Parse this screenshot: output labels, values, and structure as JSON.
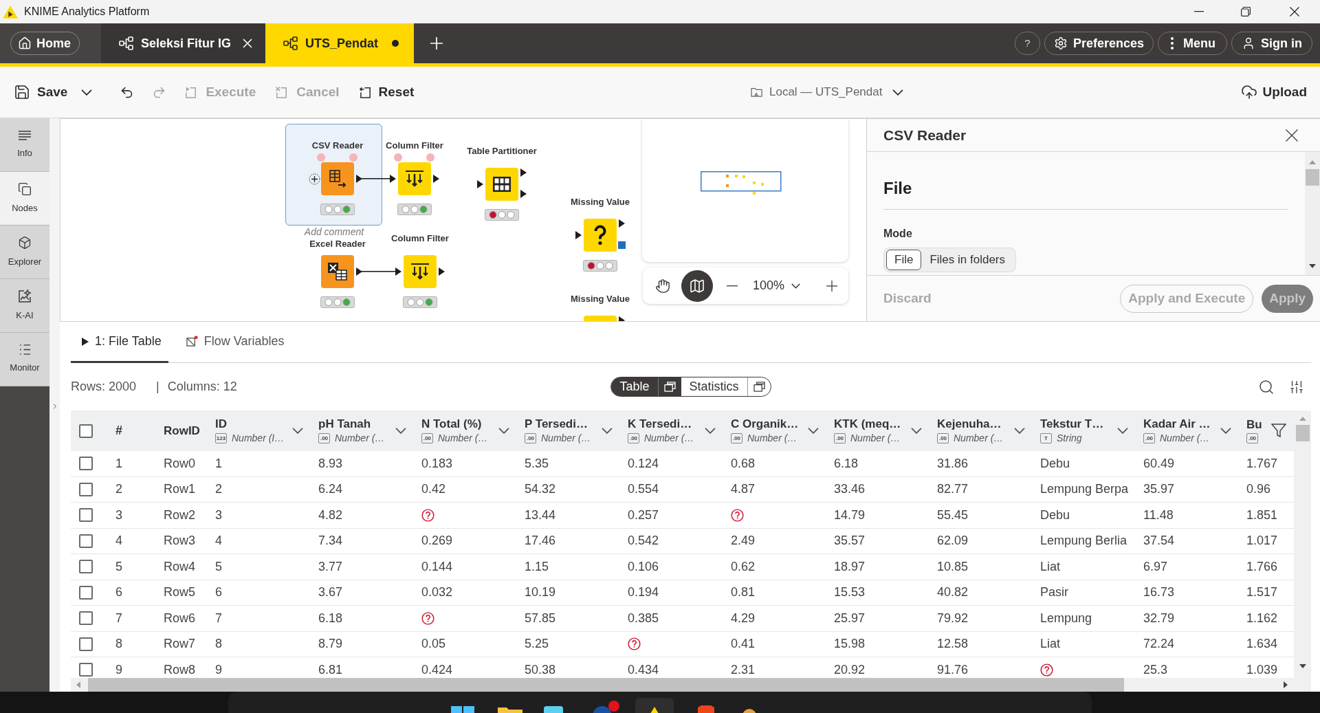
{
  "window": {
    "title": "KNIME Analytics Platform"
  },
  "app_tabs": [
    {
      "kind": "home",
      "label": "Home",
      "selected": false
    },
    {
      "kind": "workflow",
      "label": "Seleksi Fitur IG",
      "selected": false,
      "unsaved": false
    },
    {
      "kind": "workflow",
      "label": "UTS_Pendat",
      "selected": true,
      "unsaved": true
    }
  ],
  "header_actions": [
    {
      "kind": "help",
      "label": "?"
    },
    {
      "kind": "preferences",
      "label": "Preferences"
    },
    {
      "kind": "menu",
      "label": "Menu"
    },
    {
      "kind": "sign_in",
      "label": "Sign in"
    }
  ],
  "toolbar": {
    "actions": [
      {
        "kind": "save",
        "label": "Save",
        "disabled": false
      },
      {
        "kind": "save_options",
        "disabled": false
      },
      {
        "kind": "undo",
        "disabled": false
      },
      {
        "kind": "redo",
        "disabled": true
      },
      {
        "kind": "execute",
        "label": "Execute",
        "disabled": true
      },
      {
        "kind": "cancel",
        "label": "Cancel",
        "disabled": true
      },
      {
        "kind": "reset",
        "label": "Reset",
        "disabled": false
      }
    ],
    "location": "Local — UTS_Pendat",
    "upload": "Upload"
  },
  "sidebar": {
    "items": [
      {
        "kind": "info",
        "label": "Info",
        "selected": false
      },
      {
        "kind": "nodes",
        "label": "Nodes",
        "selected": true
      },
      {
        "kind": "explorer",
        "label": "Explorer",
        "selected": false
      },
      {
        "kind": "kai",
        "label": "K-AI",
        "selected": false
      },
      {
        "kind": "monitor",
        "label": "Monitor",
        "selected": false
      }
    ]
  },
  "canvas": {
    "nodes": [
      {
        "kind": "csv_reader",
        "label": "CSV Reader",
        "selected": true,
        "flow_ports": true,
        "connected": false,
        "configured": true,
        "executed": true,
        "comment_placeholder": "Add comment"
      },
      {
        "kind": "column_filter",
        "label": "Column Filter",
        "selected": false,
        "flow_ports": true,
        "connected": true,
        "configured": true,
        "executed": true
      },
      {
        "kind": "table_partitioner",
        "label": "Table Partitioner",
        "selected": false,
        "flow_ports": false,
        "connected": false,
        "configured": false,
        "executed": false
      },
      {
        "kind": "missing_value",
        "label": "Missing Value",
        "selected": false,
        "flow_ports": false,
        "connected": false,
        "configured": false,
        "executed": false
      },
      {
        "kind": "excel_reader",
        "label": "Excel Reader",
        "selected": false,
        "flow_ports": false,
        "connected": false,
        "configured": true,
        "executed": true
      },
      {
        "kind": "column_filter",
        "label": "Column Filter",
        "selected": false,
        "flow_ports": false,
        "connected": true,
        "configured": true,
        "executed": true
      },
      {
        "kind": "missing_value",
        "label": "Missing Value",
        "selected": false,
        "flow_ports": false,
        "connected": false
      }
    ],
    "tools": [
      {
        "kind": "pan",
        "selected": false
      },
      {
        "kind": "minimap",
        "selected": true
      }
    ],
    "zoom": "100%"
  },
  "dialog": {
    "title": "CSV Reader",
    "section": "File",
    "field_label": "Mode",
    "mode_options": [
      {
        "label": "File",
        "selected": true
      },
      {
        "label": "Files in folders",
        "selected": false
      }
    ],
    "actions": [
      {
        "kind": "discard",
        "label": "Discard",
        "disabled": true
      },
      {
        "kind": "apply_execute",
        "label": "Apply and Execute",
        "disabled": true
      },
      {
        "kind": "apply",
        "label": "Apply",
        "disabled": true
      }
    ]
  },
  "output": {
    "tabs": [
      {
        "kind": "port",
        "label": "1: File Table",
        "selected": true
      },
      {
        "kind": "flow_variables",
        "label": "Flow Variables",
        "selected": false
      }
    ],
    "rows_count": "Rows: 2000",
    "separator": "|",
    "columns_count": "Columns: 12",
    "views": [
      {
        "label": "Table",
        "selected": true
      },
      {
        "label": "Statistics",
        "selected": false
      }
    ],
    "table": {
      "all_selected": false,
      "index_header": "#",
      "row_id_header": "RowID",
      "columns": [
        {
          "name": "ID",
          "type_glyph": "123",
          "type": "Number (I…"
        },
        {
          "name": "pH Tanah",
          "type_glyph": ".00",
          "type": "Number (…"
        },
        {
          "name": "N Total (%)",
          "type_glyph": ".00",
          "type": "Number (…"
        },
        {
          "name": "P Tersedi…",
          "type_glyph": ".00",
          "type": "Number (…"
        },
        {
          "name": "K Tersedi…",
          "type_glyph": ".00",
          "type": "Number (…"
        },
        {
          "name": "C Organik…",
          "type_glyph": ".00",
          "type": "Number (…"
        },
        {
          "name": "KTK (meq…",
          "type_glyph": ".00",
          "type": "Number (…"
        },
        {
          "name": "Kejenuha…",
          "type_glyph": ".00",
          "type": "Number (…"
        },
        {
          "name": "Tekstur T…",
          "type_glyph": "T",
          "type": "String"
        },
        {
          "name": "Kadar Air …",
          "type_glyph": ".00",
          "type": "Number (…"
        },
        {
          "name": "Bu",
          "type_glyph": ".00"
        }
      ],
      "rows": [
        {
          "selected": false,
          "index": "1",
          "row_id": "Row0",
          "cells": [
            "1",
            "8.93",
            "0.183",
            "5.35",
            "0.124",
            "0.68",
            "6.18",
            "31.86",
            "Debu",
            "60.49",
            "1.767"
          ]
        },
        {
          "selected": false,
          "index": "2",
          "row_id": "Row1",
          "cells": [
            "2",
            "6.24",
            "0.42",
            "54.32",
            "0.554",
            "4.87",
            "33.46",
            "82.77",
            "Lempung Berpa",
            "35.97",
            "0.96"
          ]
        },
        {
          "selected": false,
          "index": "3",
          "row_id": "Row2",
          "cells": [
            "3",
            "4.82",
            null,
            "13.44",
            "0.257",
            null,
            "14.79",
            "55.45",
            "Debu",
            "11.48",
            "1.851"
          ]
        },
        {
          "selected": false,
          "index": "4",
          "row_id": "Row3",
          "cells": [
            "4",
            "7.34",
            "0.269",
            "17.46",
            "0.542",
            "2.49",
            "35.57",
            "62.09",
            "Lempung Berlia",
            "37.54",
            "1.017"
          ]
        },
        {
          "selected": false,
          "index": "5",
          "row_id": "Row4",
          "cells": [
            "5",
            "3.77",
            "0.144",
            "1.15",
            "0.106",
            "0.62",
            "18.97",
            "10.85",
            "Liat",
            "6.97",
            "1.766"
          ]
        },
        {
          "selected": false,
          "index": "6",
          "row_id": "Row5",
          "cells": [
            "6",
            "3.67",
            "0.032",
            "10.19",
            "0.194",
            "0.81",
            "15.53",
            "40.82",
            "Pasir",
            "16.73",
            "1.517"
          ]
        },
        {
          "selected": false,
          "index": "7",
          "row_id": "Row6",
          "cells": [
            "7",
            "6.18",
            null,
            "57.85",
            "0.385",
            "4.29",
            "25.97",
            "79.92",
            "Lempung",
            "32.79",
            "1.162"
          ]
        },
        {
          "selected": false,
          "index": "8",
          "row_id": "Row7",
          "cells": [
            "8",
            "8.79",
            "0.05",
            "5.25",
            null,
            "0.41",
            "15.98",
            "12.58",
            "Liat",
            "72.24",
            "1.634"
          ]
        },
        {
          "selected": false,
          "index": "9",
          "row_id": "Row8",
          "cells": [
            "9",
            "6.81",
            "0.424",
            "50.38",
            "0.434",
            "2.31",
            "20.92",
            "91.76",
            null,
            "25.3",
            "1.039"
          ]
        }
      ]
    }
  }
}
